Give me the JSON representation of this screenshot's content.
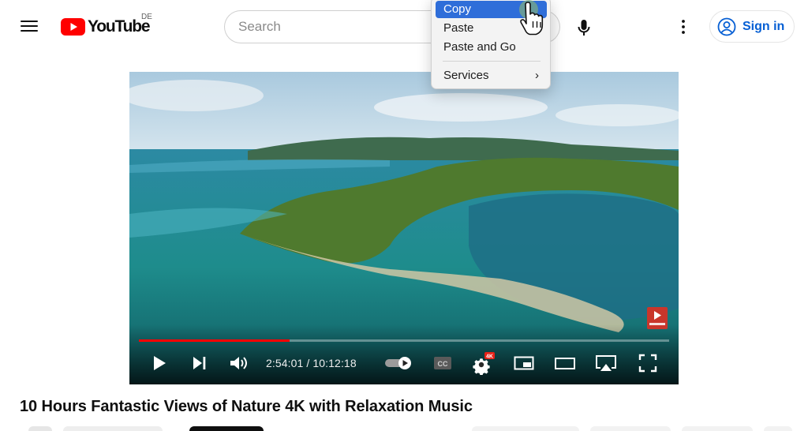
{
  "header": {
    "logo_text": "YouTube",
    "country_code": "DE",
    "search_placeholder": "Search",
    "sign_in_label": "Sign in",
    "icons": [
      "menu-icon",
      "youtube-logo-icon",
      "microphone-icon",
      "more-vert-icon",
      "account-circle-icon"
    ],
    "brand_color": "#ff0000",
    "link_color": "#065fd4"
  },
  "context_menu": {
    "items": [
      {
        "label": "Copy",
        "active": true
      },
      {
        "label": "Paste"
      },
      {
        "label": "Paste and Go"
      },
      {
        "label": "Services",
        "submenu": true
      }
    ],
    "highlight_color": "#2f6ed9"
  },
  "player": {
    "current_time": "2:54:01",
    "duration": "10:12:18",
    "time_separator": " / ",
    "progress_fraction": 0.2835,
    "settings_badge": "4K",
    "autoplay_on": true,
    "controls": [
      "play-icon",
      "next-icon",
      "volume-icon",
      "autoplay-toggle-icon",
      "captions-icon",
      "settings-icon",
      "miniplayer-icon",
      "theater-icon",
      "airplay-icon",
      "fullscreen-icon"
    ],
    "progress_color": "#ff0000"
  },
  "video": {
    "title": "10 Hours Fantastic Views of Nature 4K with Relaxation Music"
  }
}
